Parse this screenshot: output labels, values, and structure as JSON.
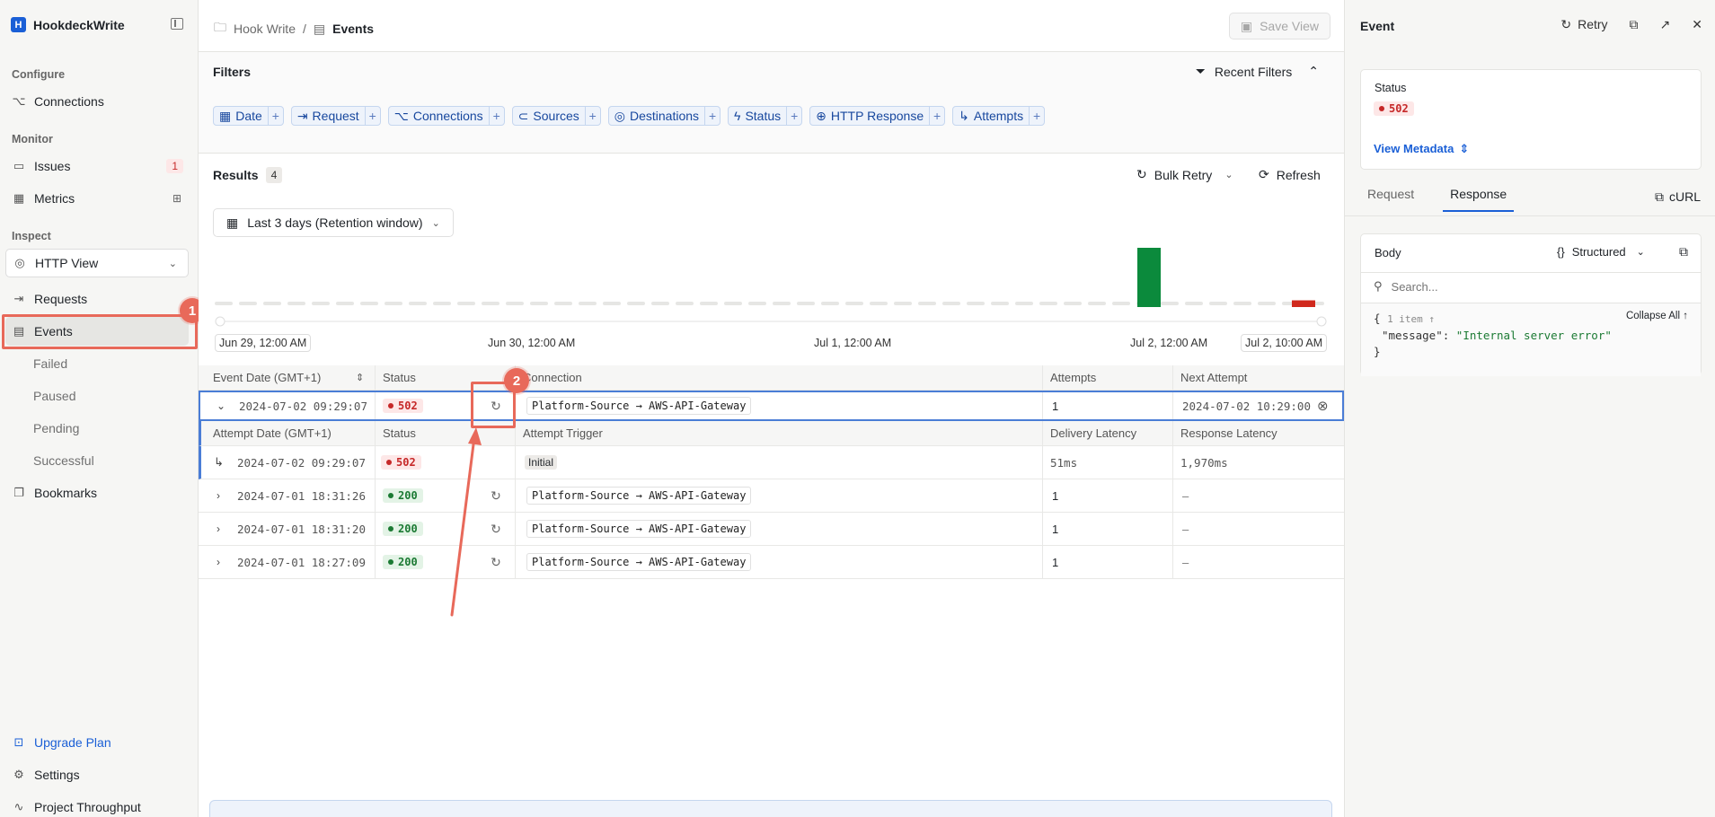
{
  "sidebar": {
    "brand": "HookdeckWrite",
    "sections": {
      "configure": "Configure",
      "monitor": "Monitor",
      "inspect": "Inspect"
    },
    "connections": "Connections",
    "issues": "Issues",
    "issues_count": "1",
    "metrics": "Metrics",
    "http_view": "HTTP View",
    "requests": "Requests",
    "events": "Events",
    "failed": "Failed",
    "paused": "Paused",
    "pending": "Pending",
    "successful": "Successful",
    "bookmarks": "Bookmarks",
    "upgrade_plan": "Upgrade Plan",
    "settings": "Settings",
    "project_throughput": "Project Throughput"
  },
  "annotations": {
    "one": "1",
    "two": "2"
  },
  "topbar": {
    "crumb_project": "Hook Write",
    "crumb_sep": "/",
    "crumb_page": "Events",
    "save_view": "Save View"
  },
  "filters": {
    "title": "Filters",
    "recent": "Recent Filters",
    "chips": [
      "Date",
      "Request",
      "Connections",
      "Sources",
      "Destinations",
      "Status",
      "HTTP Response",
      "Attempts"
    ],
    "plus": "+"
  },
  "results": {
    "label": "Results",
    "count": "4",
    "bulk_retry": "Bulk Retry",
    "refresh": "Refresh",
    "date_range": "Last 3 days (Retention window)"
  },
  "histogram": {
    "ticks": [
      "Jun 29, 12:00 AM",
      "Jun 30, 12:00 AM",
      "Jul 1, 12:00 AM",
      "Jul 2, 12:00 AM",
      "Jul 2, 10:00 AM"
    ],
    "bars": [
      {
        "status": "success",
        "color": "#0b8a3c",
        "value": 3
      },
      {
        "status": "error",
        "color": "#d0291d",
        "value": 1
      }
    ]
  },
  "table": {
    "headers": {
      "date": "Event Date (GMT+1)",
      "status": "Status",
      "connection": "Connection",
      "attempts": "Attempts",
      "next": "Next Attempt"
    },
    "sub_headers": {
      "date": "Attempt Date (GMT+1)",
      "status": "Status",
      "trigger": "Attempt Trigger",
      "delivery": "Delivery Latency",
      "response": "Response Latency"
    },
    "expanded": {
      "date": "2024-07-02 09:29:07",
      "status": "502",
      "connection": "Platform-Source → AWS-API-Gateway",
      "attempts": "1",
      "next": "2024-07-02 10:29:00"
    },
    "attempt": {
      "date": "2024-07-02 09:29:07",
      "status": "502",
      "trigger": "Initial",
      "delivery": "51ms",
      "response": "1,970ms"
    },
    "rows": [
      {
        "date": "2024-07-01 18:31:26",
        "status": "200",
        "connection": "Platform-Source → AWS-API-Gateway",
        "attempts": "1",
        "next": "–"
      },
      {
        "date": "2024-07-01 18:31:20",
        "status": "200",
        "connection": "Platform-Source → AWS-API-Gateway",
        "attempts": "1",
        "next": "–"
      },
      {
        "date": "2024-07-01 18:27:09",
        "status": "200",
        "connection": "Platform-Source → AWS-API-Gateway",
        "attempts": "1",
        "next": "–"
      }
    ]
  },
  "panel": {
    "title": "Event",
    "retry": "Retry",
    "status_label": "Status",
    "status_value": "502",
    "view_metadata": "View Metadata",
    "tab_request": "Request",
    "tab_response": "Response",
    "curl": "cURL",
    "body": "Body",
    "structured": "Structured",
    "search_placeholder": "Search...",
    "collapse_all": "Collapse All ↑",
    "json_open": "{",
    "json_meta": "1 item ↑",
    "json_key": "\"message\"",
    "json_colon": ":",
    "json_value": "\"Internal server error\"",
    "json_close": "}"
  },
  "colors": {
    "accent": "#1a5fd6",
    "error": "#c62828",
    "success": "#1b7a33",
    "annotation": "#e8695a"
  }
}
